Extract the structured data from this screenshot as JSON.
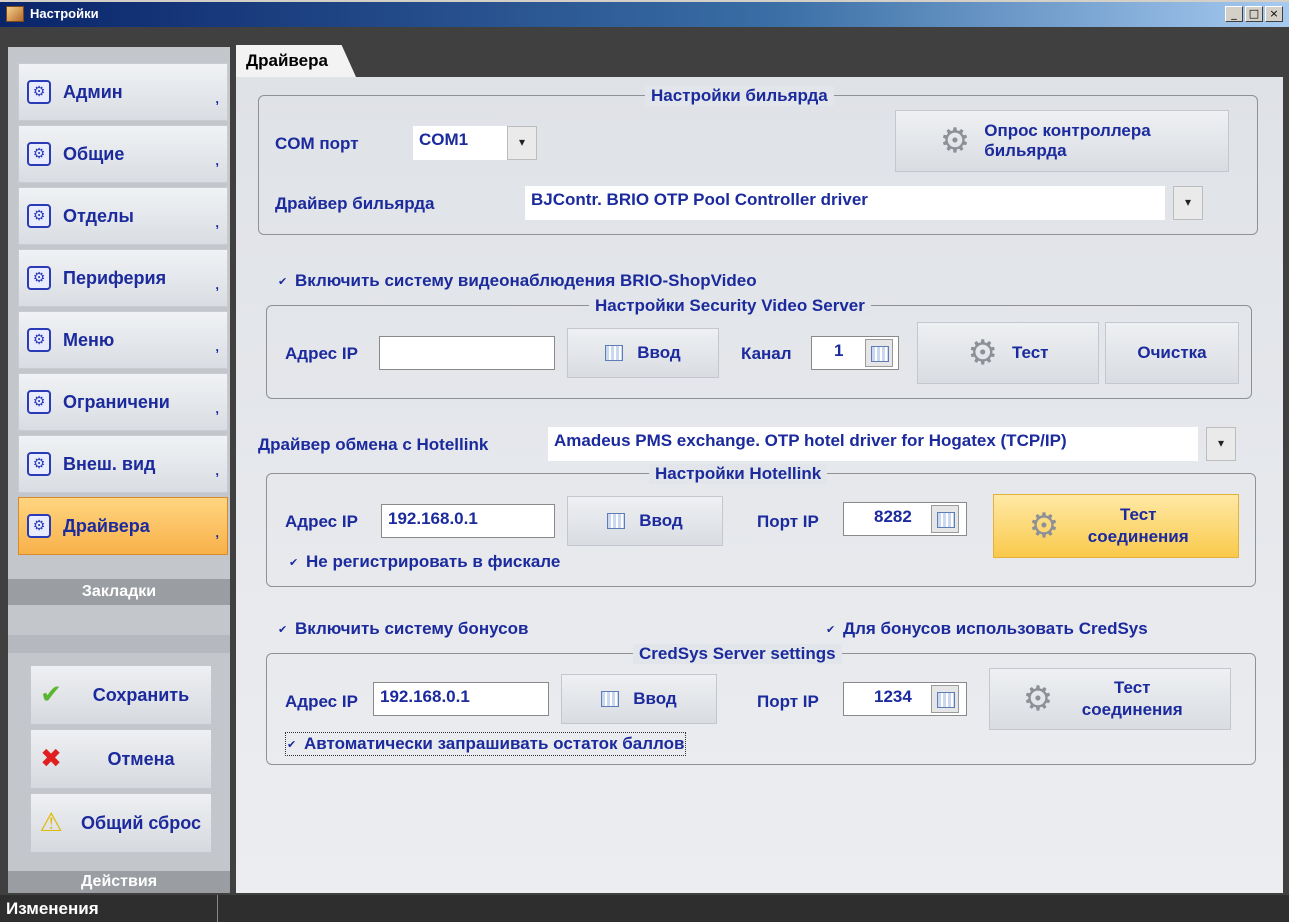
{
  "window": {
    "title": "Настройки",
    "buttons": [
      "_",
      "□",
      "×"
    ]
  },
  "sidebar": {
    "items": [
      {
        "label": "Админ"
      },
      {
        "label": "Общие"
      },
      {
        "label": "Отделы"
      },
      {
        "label": "Периферия"
      },
      {
        "label": "Меню"
      },
      {
        "label": "Ограничени"
      },
      {
        "label": "Внеш. вид"
      },
      {
        "label": "Драйвера"
      }
    ],
    "bookmarks_caption": "Закладки",
    "actions": [
      {
        "label": "Сохранить",
        "icon": "checkmark-icon"
      },
      {
        "label": "Отмена",
        "icon": "red-x-icon"
      },
      {
        "label": "Общий сброс",
        "icon": "warning-icon"
      }
    ],
    "actions_caption": "Действия"
  },
  "status": {
    "text": "Изменения"
  },
  "tab": {
    "label": "Драйвера"
  },
  "billiard": {
    "legend": "Настройки бильярда",
    "com_label": "COM порт",
    "com_value": "COM1",
    "poll_button": "Опрос контроллера бильярда",
    "driver_label": "Драйвер бильярда",
    "driver_value": "BJContr. BRIO OTP Pool Controller driver"
  },
  "video": {
    "enable_label": "Включить систему видеонаблюдения BRIO-ShopVideo",
    "legend": "Настройки Security Video Server",
    "ip_label": "Адрес IP",
    "ip_value": "",
    "enter_button": "Ввод",
    "channel_label": "Канал",
    "channel_value": "1",
    "test_button": "Тест",
    "clear_button": "Очистка"
  },
  "hotellink": {
    "driver_label": "Драйвер обмена с Hotellink",
    "driver_value": "Amadeus PMS exchange. OTP hotel driver for Hogatex (TCP/IP)",
    "legend": "Настройки Hotellink",
    "ip_label": "Адрес IP",
    "ip_value": "192.168.0.1",
    "enter_button": "Ввод",
    "port_label": "Порт IP",
    "port_value": "8282",
    "test_button": "Тест соединения",
    "fiscal_label": "Не регистрировать в фискале"
  },
  "bonus": {
    "enable_label": "Включить систему бонусов",
    "credsys_label": "Для бонусов использовать CredSys",
    "legend": "CredSys Server settings",
    "ip_label": "Адрес IP",
    "ip_value": "192.168.0.1",
    "enter_button": "Ввод",
    "port_label": "Порт IP",
    "port_value": "1234",
    "test_button": "Тест соединения",
    "auto_label": "Автоматически запрашивать остаток баллов"
  }
}
